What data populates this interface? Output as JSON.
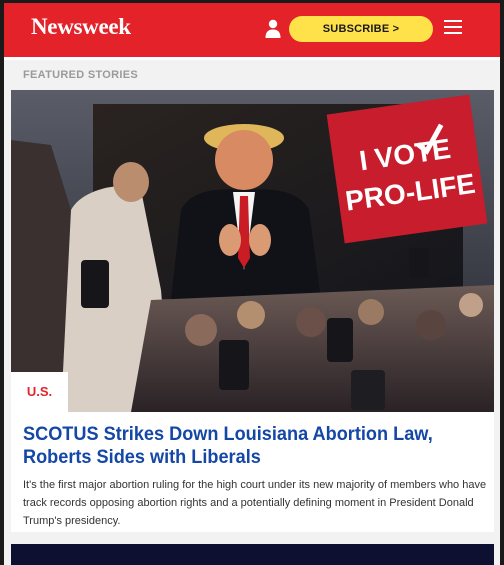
{
  "header": {
    "logo_text": "Newsweek",
    "subscribe_label": "SUBSCRIBE >",
    "brand_color": "#e4222a",
    "subscribe_color": "#ffe14a",
    "icons": [
      "user-icon",
      "hamburger-menu-icon"
    ]
  },
  "featured": {
    "section_title": "FEATURED STORIES",
    "story": {
      "category": "U.S.",
      "headline": "SCOTUS Strikes Down Louisiana Abortion Law, Roberts Sides with Liberals",
      "summary": "It's the first major abortion ruling for the high court under its new majority of members who have track records opposing abortion rights and a potentially defining moment in President Donald Trump's presidency.",
      "image_sign_line1": "I VOTE",
      "image_sign_line2": "PRO-LIFE",
      "headline_color": "#1447a6"
    }
  }
}
